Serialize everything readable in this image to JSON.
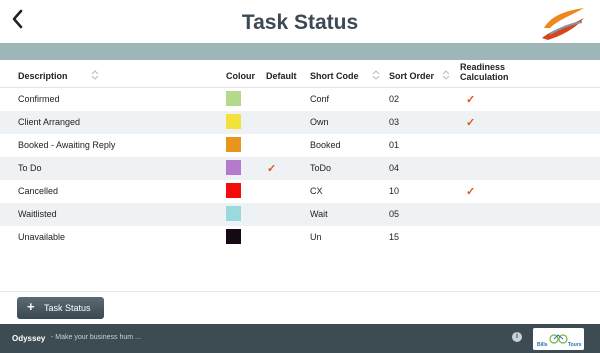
{
  "header": {
    "title": "Task Status"
  },
  "columns": {
    "description": "Description",
    "colour": "Colour",
    "default": "Default",
    "short_code": "Short Code",
    "sort_order": "Sort Order",
    "readiness_line1": "Readiness",
    "readiness_line2": "Calculation"
  },
  "rows": [
    {
      "description": "Confirmed",
      "colour": "#b4d98c",
      "default": false,
      "short_code": "Conf",
      "sort_order": "02",
      "readiness": true
    },
    {
      "description": "Client Arranged",
      "colour": "#f4e23c",
      "default": false,
      "short_code": "Own",
      "sort_order": "03",
      "readiness": true
    },
    {
      "description": "Booked - Awaiting Reply",
      "colour": "#e8951e",
      "default": false,
      "short_code": "Booked",
      "sort_order": "01",
      "readiness": false
    },
    {
      "description": "To Do",
      "colour": "#b47bcc",
      "default": true,
      "short_code": "ToDo",
      "sort_order": "04",
      "readiness": false
    },
    {
      "description": "Cancelled",
      "colour": "#f20c0c",
      "default": false,
      "short_code": "CX",
      "sort_order": "10",
      "readiness": true
    },
    {
      "description": "Waitlisted",
      "colour": "#9ad9dc",
      "default": false,
      "short_code": "Wait",
      "sort_order": "05",
      "readiness": false
    },
    {
      "description": "Unavailable",
      "colour": "#150a14",
      "default": false,
      "short_code": "Un",
      "sort_order": "15",
      "readiness": false
    }
  ],
  "tick_symbol": "✓",
  "actions": {
    "add_label": "Task Status",
    "add_icon": "+"
  },
  "footer": {
    "brand": "Odyssey",
    "tagline": "- Make your business hum ...",
    "info_icon": "i",
    "partner_logo_text": "Bills Tours"
  },
  "colors": {
    "accent": "#e2541c",
    "band": "#9fb6b9",
    "footer": "#3d4b52",
    "title": "#3b4a55"
  }
}
